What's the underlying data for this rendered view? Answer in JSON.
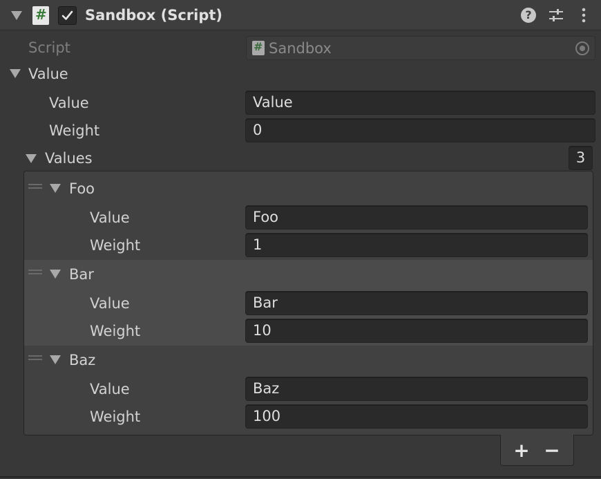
{
  "component": {
    "title": "Sandbox (Script)",
    "enabled": true,
    "script_label": "Script",
    "script_value": "Sandbox"
  },
  "value": {
    "label": "Value",
    "value_label": "Value",
    "value": "Value",
    "weight_label": "Weight",
    "weight": "0"
  },
  "values": {
    "label": "Values",
    "count": "3",
    "items": [
      {
        "name": "Foo",
        "value_label": "Value",
        "value": "Foo",
        "weight_label": "Weight",
        "weight": "1"
      },
      {
        "name": "Bar",
        "value_label": "Value",
        "value": "Bar",
        "weight_label": "Weight",
        "weight": "10"
      },
      {
        "name": "Baz",
        "value_label": "Value",
        "value": "Baz",
        "weight_label": "Weight",
        "weight": "100"
      }
    ],
    "add_label": "+",
    "remove_label": "−"
  }
}
